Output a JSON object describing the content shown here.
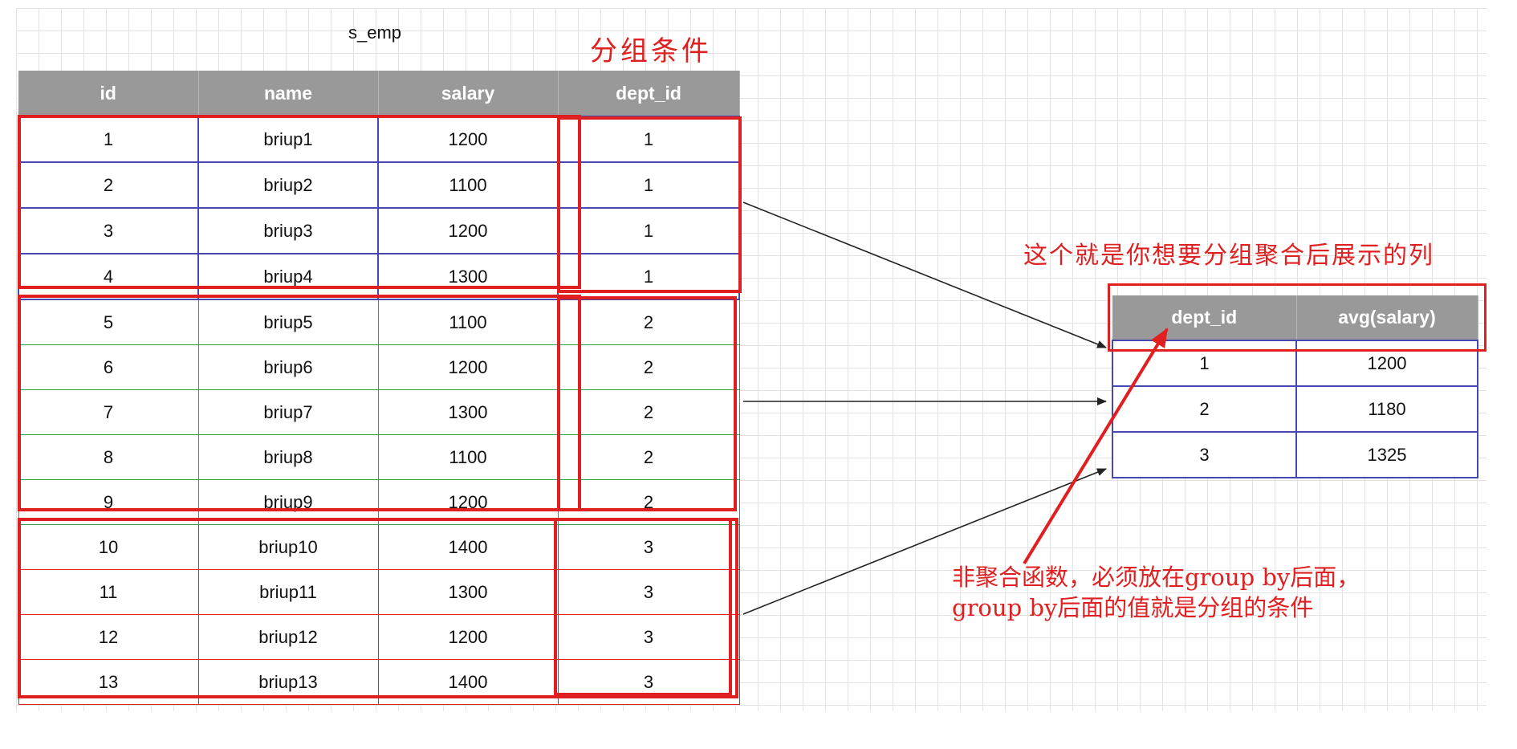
{
  "source_table": {
    "title": "s_emp",
    "columns": [
      "id",
      "name",
      "salary",
      "dept_id"
    ],
    "rows": [
      [
        "1",
        "briup1",
        "1200",
        "1"
      ],
      [
        "2",
        "briup2",
        "1100",
        "1"
      ],
      [
        "3",
        "briup3",
        "1200",
        "1"
      ],
      [
        "4",
        "briup4",
        "1300",
        "1"
      ],
      [
        "5",
        "briup5",
        "1100",
        "2"
      ],
      [
        "6",
        "briup6",
        "1200",
        "2"
      ],
      [
        "7",
        "briup7",
        "1300",
        "2"
      ],
      [
        "8",
        "briup8",
        "1100",
        "2"
      ],
      [
        "9",
        "briup9",
        "1200",
        "2"
      ],
      [
        "10",
        "briup10",
        "1400",
        "3"
      ],
      [
        "11",
        "briup11",
        "1300",
        "3"
      ],
      [
        "12",
        "briup12",
        "1200",
        "3"
      ],
      [
        "13",
        "briup13",
        "1400",
        "3"
      ]
    ]
  },
  "result_table": {
    "columns": [
      "dept_id",
      "avg(salary)"
    ],
    "rows": [
      [
        "1",
        "1200"
      ],
      [
        "2",
        "1180"
      ],
      [
        "3",
        "1325"
      ]
    ]
  },
  "annotations": {
    "group_condition": "分组条件",
    "display_columns": "这个就是你想要分组聚合后展示的列",
    "note_line1": "非聚合函数，必须放在group by后面，",
    "note_line2": "group by后面的值就是分组的条件"
  },
  "colors": {
    "header_bg": "#999999",
    "group1_border": "#4448b0",
    "group2_border": "#2aa44a",
    "group3_border": "#e02222",
    "highlight": "#e02020",
    "arrow": "#222222"
  }
}
